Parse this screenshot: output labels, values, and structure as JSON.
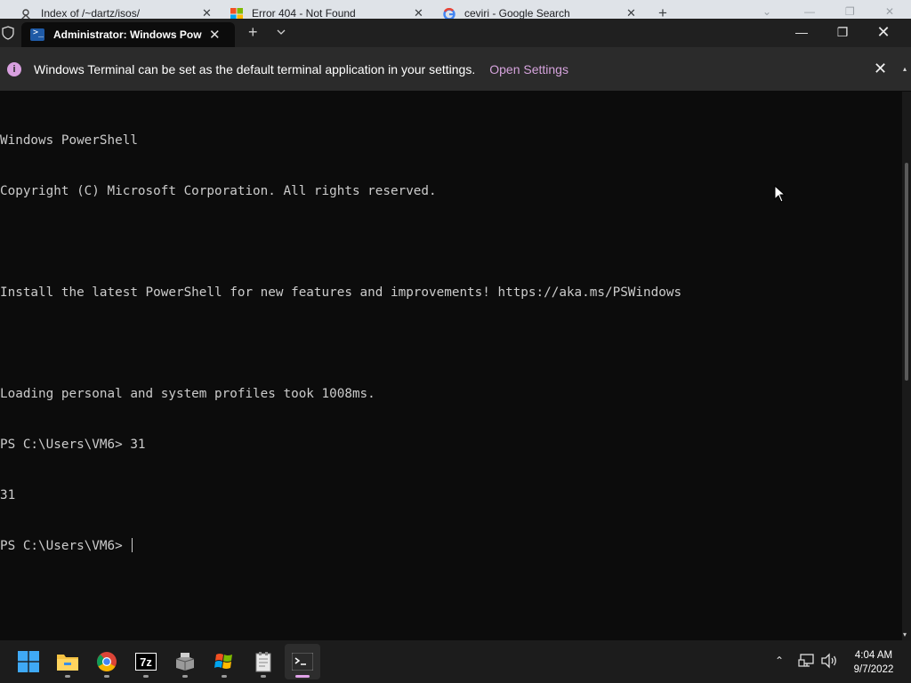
{
  "browser": {
    "tabs": [
      {
        "title": "Index of /~dartz/isos/",
        "icon": "web-page-icon",
        "close": "✕"
      },
      {
        "title": "Error 404 - Not Found",
        "icon": "microsoft-logo-icon",
        "close": "✕"
      },
      {
        "title": "ceviri - Google Search",
        "icon": "google-icon",
        "close": "✕"
      }
    ],
    "new_tab": "+"
  },
  "terminal": {
    "tab_title": "Administrator: Windows PowerShell",
    "tab_close": "✕",
    "new_tab": "+",
    "window_controls": {
      "minimize": "—",
      "maximize": "❐",
      "close": "✕"
    },
    "infobar": {
      "message": "Windows Terminal can be set as the default terminal application in your settings.",
      "link": "Open Settings",
      "close": "✕"
    },
    "output": [
      "Windows PowerShell",
      "Copyright (C) Microsoft Corporation. All rights reserved.",
      "",
      "Install the latest PowerShell for new features and improvements! https://aka.ms/PSWindows",
      "",
      "Loading personal and system profiles took 1008ms.",
      "PS C:\\Users\\VM6> 31",
      "31"
    ],
    "prompt": "PS C:\\Users\\VM6> "
  },
  "taskbar": {
    "items": [
      {
        "name": "start-button",
        "icon": "windows-logo-icon"
      },
      {
        "name": "file-explorer",
        "icon": "folder-icon"
      },
      {
        "name": "chrome",
        "icon": "chrome-icon"
      },
      {
        "name": "7zip",
        "icon": "7zip-icon",
        "label": "7z"
      },
      {
        "name": "installer",
        "icon": "installer-box-icon"
      },
      {
        "name": "winrar-app",
        "icon": "windows-flag-icon"
      },
      {
        "name": "notepad-app",
        "icon": "notepad-icon"
      },
      {
        "name": "windows-terminal",
        "icon": "terminal-icon"
      }
    ],
    "tray": {
      "chevron": "⌃"
    },
    "clock": {
      "time": "4:04 AM",
      "date": "9/7/2022"
    }
  },
  "colors": {
    "terminal_bg": "#0c0c0c",
    "titlebar_bg": "#202020",
    "infobar_bg": "#2b2b2b",
    "accent_link": "#d5a3dc",
    "taskbar_bg": "#1c1c1c"
  }
}
